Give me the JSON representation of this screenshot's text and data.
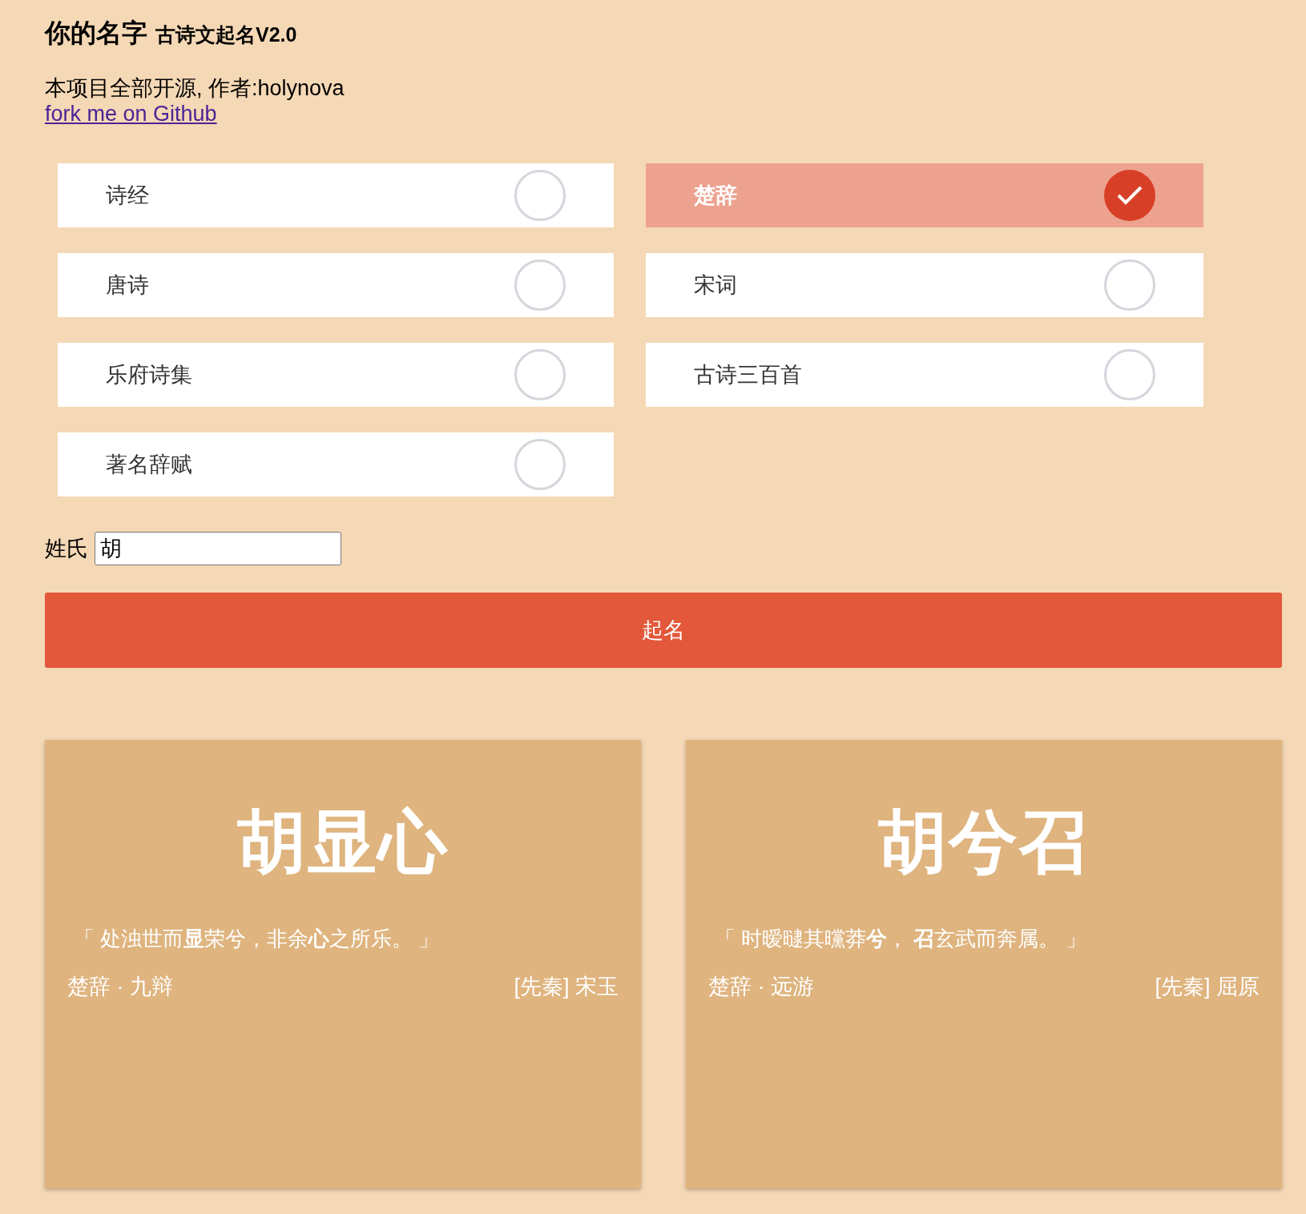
{
  "header": {
    "title": "你的名字",
    "subtitle": "古诗文起名V2.0",
    "info": "本项目全部开源, 作者:holynova",
    "link": "fork me on Github"
  },
  "books": [
    {
      "label": "诗经",
      "selected": false
    },
    {
      "label": "楚辞",
      "selected": true
    },
    {
      "label": "唐诗",
      "selected": false
    },
    {
      "label": "宋词",
      "selected": false
    },
    {
      "label": "乐府诗集",
      "selected": false
    },
    {
      "label": "古诗三百首",
      "selected": false
    },
    {
      "label": "著名辞赋",
      "selected": false
    }
  ],
  "surname": {
    "label": "姓氏",
    "value": "胡"
  },
  "submit": "起名",
  "results": [
    {
      "name": "胡显心",
      "quote": "「 处浊世而**显**荣兮，非余**心**之所乐。 」",
      "source": "楚辞 · 九辩",
      "author": "[先秦] 宋玉"
    },
    {
      "name": "胡兮召",
      "quote": "「 时暧曃其曭莽**兮**， **召**玄武而奔属。 」",
      "source": "楚辞 · 远游",
      "author": "[先秦] 屈原"
    }
  ]
}
